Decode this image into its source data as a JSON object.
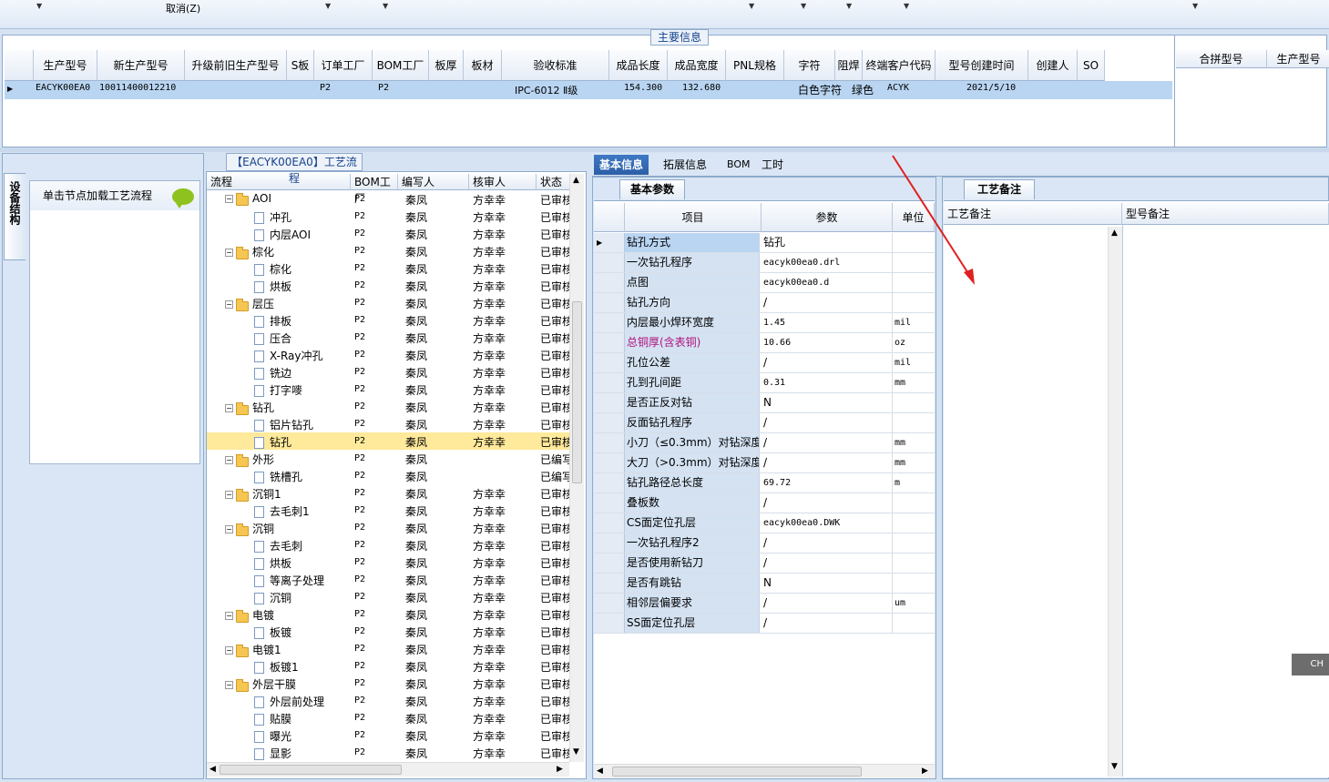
{
  "toolbar": {
    "cancel_label": "取消(Z)"
  },
  "main_info": {
    "group_title": "主要信息",
    "columns": [
      "生产型号",
      "新生产型号",
      "升级前旧生产型号",
      "S板",
      "订单工厂",
      "BOM工厂",
      "板厚",
      "板材",
      "验收标准",
      "成品长度",
      "成品宽度",
      "PNL规格",
      "字符",
      "阻焊",
      "终端客户代码",
      "型号创建时间",
      "创建人",
      "SO"
    ],
    "row": {
      "model": "EACYK00EA0",
      "new_model": "10011400012210",
      "order_factory": "P2",
      "bom_factory": "P2",
      "standard": "IPC-6012 Ⅱ级",
      "length": "154.300",
      "width": "132.680",
      "char": "白色字符",
      "solder": "绿色",
      "customer": "ACYK",
      "created": "2021/5/10"
    },
    "side_columns": [
      "合拼型号",
      "生产型号"
    ]
  },
  "left_panel": {
    "vertical_tab": "设备结构",
    "load_hint": "单击节点加载工艺流程"
  },
  "tree": {
    "title": "【EACYK00EA0】工艺流程",
    "columns": [
      "流程",
      "BOM工厂",
      "编写人",
      "核审人",
      "状态"
    ],
    "rows": [
      {
        "name": "AOI",
        "level": 0,
        "factory": "P2",
        "writer": "秦凤",
        "reviewer": "方幸幸",
        "status": "已审核"
      },
      {
        "name": "冲孔",
        "level": 1,
        "factory": "P2",
        "writer": "秦凤",
        "reviewer": "方幸幸",
        "status": "已审核"
      },
      {
        "name": "内层AOI",
        "level": 1,
        "factory": "P2",
        "writer": "秦凤",
        "reviewer": "方幸幸",
        "status": "已审核"
      },
      {
        "name": "棕化",
        "level": 0,
        "factory": "P2",
        "writer": "秦凤",
        "reviewer": "方幸幸",
        "status": "已审核"
      },
      {
        "name": "棕化",
        "level": 1,
        "factory": "P2",
        "writer": "秦凤",
        "reviewer": "方幸幸",
        "status": "已审核"
      },
      {
        "name": "烘板",
        "level": 1,
        "factory": "P2",
        "writer": "秦凤",
        "reviewer": "方幸幸",
        "status": "已审核"
      },
      {
        "name": "层压",
        "level": 0,
        "factory": "P2",
        "writer": "秦凤",
        "reviewer": "方幸幸",
        "status": "已审核"
      },
      {
        "name": "排板",
        "level": 1,
        "factory": "P2",
        "writer": "秦凤",
        "reviewer": "方幸幸",
        "status": "已审核"
      },
      {
        "name": "压合",
        "level": 1,
        "factory": "P2",
        "writer": "秦凤",
        "reviewer": "方幸幸",
        "status": "已审核"
      },
      {
        "name": "X-Ray冲孔",
        "level": 1,
        "factory": "P2",
        "writer": "秦凤",
        "reviewer": "方幸幸",
        "status": "已审核"
      },
      {
        "name": "铣边",
        "level": 1,
        "factory": "P2",
        "writer": "秦凤",
        "reviewer": "方幸幸",
        "status": "已审核"
      },
      {
        "name": "打字嘜",
        "level": 1,
        "factory": "P2",
        "writer": "秦凤",
        "reviewer": "方幸幸",
        "status": "已审核"
      },
      {
        "name": "钻孔",
        "level": 0,
        "factory": "P2",
        "writer": "秦凤",
        "reviewer": "方幸幸",
        "status": "已审核"
      },
      {
        "name": "铝片钻孔",
        "level": 1,
        "factory": "P2",
        "writer": "秦凤",
        "reviewer": "方幸幸",
        "status": "已审核"
      },
      {
        "name": "钻孔",
        "level": 1,
        "factory": "P2",
        "writer": "秦凤",
        "reviewer": "方幸幸",
        "status": "已审核",
        "selected": true
      },
      {
        "name": "外形",
        "level": 0,
        "factory": "P2",
        "writer": "秦凤",
        "reviewer": "",
        "status": "已编写"
      },
      {
        "name": "铣槽孔",
        "level": 1,
        "factory": "P2",
        "writer": "秦凤",
        "reviewer": "",
        "status": "已编写"
      },
      {
        "name": "沉铜1",
        "level": 0,
        "factory": "P2",
        "writer": "秦凤",
        "reviewer": "方幸幸",
        "status": "已审核"
      },
      {
        "name": "去毛刺1",
        "level": 1,
        "factory": "P2",
        "writer": "秦凤",
        "reviewer": "方幸幸",
        "status": "已审核"
      },
      {
        "name": "沉铜",
        "level": 0,
        "factory": "P2",
        "writer": "秦凤",
        "reviewer": "方幸幸",
        "status": "已审核"
      },
      {
        "name": "去毛刺",
        "level": 1,
        "factory": "P2",
        "writer": "秦凤",
        "reviewer": "方幸幸",
        "status": "已审核"
      },
      {
        "name": "烘板",
        "level": 1,
        "factory": "P2",
        "writer": "秦凤",
        "reviewer": "方幸幸",
        "status": "已审核"
      },
      {
        "name": "等离子处理",
        "level": 1,
        "factory": "P2",
        "writer": "秦凤",
        "reviewer": "方幸幸",
        "status": "已审核"
      },
      {
        "name": "沉铜",
        "level": 1,
        "factory": "P2",
        "writer": "秦凤",
        "reviewer": "方幸幸",
        "status": "已审核"
      },
      {
        "name": "电镀",
        "level": 0,
        "factory": "P2",
        "writer": "秦凤",
        "reviewer": "方幸幸",
        "status": "已审核"
      },
      {
        "name": "板镀",
        "level": 1,
        "factory": "P2",
        "writer": "秦凤",
        "reviewer": "方幸幸",
        "status": "已审核"
      },
      {
        "name": "电镀1",
        "level": 0,
        "factory": "P2",
        "writer": "秦凤",
        "reviewer": "方幸幸",
        "status": "已审核"
      },
      {
        "name": "板镀1",
        "level": 1,
        "factory": "P2",
        "writer": "秦凤",
        "reviewer": "方幸幸",
        "status": "已审核"
      },
      {
        "name": "外层干膜",
        "level": 0,
        "factory": "P2",
        "writer": "秦凤",
        "reviewer": "方幸幸",
        "status": "已审核"
      },
      {
        "name": "外层前处理",
        "level": 1,
        "factory": "P2",
        "writer": "秦凤",
        "reviewer": "方幸幸",
        "status": "已审核"
      },
      {
        "name": "贴膜",
        "level": 1,
        "factory": "P2",
        "writer": "秦凤",
        "reviewer": "方幸幸",
        "status": "已审核"
      },
      {
        "name": "曝光",
        "level": 1,
        "factory": "P2",
        "writer": "秦凤",
        "reviewer": "方幸幸",
        "status": "已审核"
      },
      {
        "name": "显影",
        "level": 1,
        "factory": "P2",
        "writer": "秦凤",
        "reviewer": "方幸幸",
        "status": "已审核"
      }
    ]
  },
  "tabs": [
    "基本信息",
    "拓展信息",
    "BOM",
    "工时"
  ],
  "basic": {
    "subtab": "基本参数",
    "columns": [
      "项目",
      "参数",
      "单位"
    ],
    "rows": [
      {
        "item": "钻孔方式",
        "value": "钻孔",
        "unit": ""
      },
      {
        "item": "一次钻孔程序",
        "value": "eacyk00ea0.drl",
        "unit": ""
      },
      {
        "item": "点图",
        "value": "eacyk00ea0.d",
        "unit": ""
      },
      {
        "item": "钻孔方向",
        "value": "/",
        "unit": ""
      },
      {
        "item": "内层最小焊环宽度",
        "value": "1.45",
        "unit": "mil"
      },
      {
        "item": "总铜厚(含表铜)",
        "value": "10.66",
        "unit": "oz",
        "highlight": true
      },
      {
        "item": "孔位公差",
        "value": "/",
        "unit": "mil"
      },
      {
        "item": "孔到孔间距",
        "value": "0.31",
        "unit": "mm"
      },
      {
        "item": "是否正反对钻",
        "value": "N",
        "unit": ""
      },
      {
        "item": "反面钻孔程序",
        "value": "/",
        "unit": ""
      },
      {
        "item": "小刀（≤0.3mm）对钻深度",
        "value": "/",
        "unit": "mm"
      },
      {
        "item": "大刀（>0.3mm）对钻深度",
        "value": "/",
        "unit": "mm"
      },
      {
        "item": "钻孔路径总长度",
        "value": "69.72",
        "unit": "m"
      },
      {
        "item": "叠板数",
        "value": "/",
        "unit": ""
      },
      {
        "item": "CS面定位孔层",
        "value": "eacyk00ea0.DWK",
        "unit": ""
      },
      {
        "item": "一次钻孔程序2",
        "value": "/",
        "unit": ""
      },
      {
        "item": "是否使用新钻刀",
        "value": "/",
        "unit": ""
      },
      {
        "item": "是否有跳钻",
        "value": "N",
        "unit": ""
      },
      {
        "item": "相邻层偏要求",
        "value": "/",
        "unit": "um"
      },
      {
        "item": "SS面定位孔层",
        "value": "/",
        "unit": ""
      }
    ]
  },
  "remarks": {
    "tab": "工艺备注",
    "columns": [
      "工艺备注",
      "型号备注"
    ]
  },
  "ime_badge": "CH",
  "colors": {
    "accent": "#2b5fa6",
    "selection": "#b9d5f2",
    "tree_selection": "#ffe99a",
    "arrow": "#e02020"
  }
}
